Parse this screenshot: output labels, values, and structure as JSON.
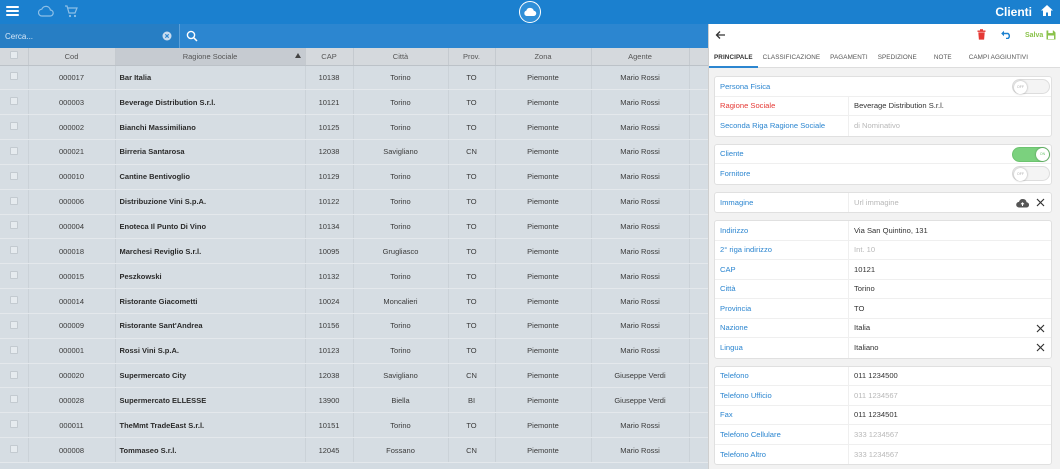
{
  "app": {
    "title": "Clienti",
    "icons": {
      "menu": "hamburger-icon",
      "cloud": "cloud-icon",
      "cart": "cart-icon",
      "home": "home-icon"
    }
  },
  "search": {
    "placeholder": "Cerca..."
  },
  "table": {
    "headers": [
      "Cod",
      "Ragione Sociale",
      "CAP",
      "Città",
      "Prov.",
      "Zona",
      "Agente"
    ],
    "sorted_column": "Ragione Sociale",
    "rows": [
      {
        "cod": "000017",
        "name": "Bar Italia",
        "cap": "10138",
        "city": "Torino",
        "prov": "TO",
        "zone": "Piemonte",
        "agent": "Mario Rossi"
      },
      {
        "cod": "000003",
        "name": "Beverage Distribution S.r.l.",
        "cap": "10121",
        "city": "Torino",
        "prov": "TO",
        "zone": "Piemonte",
        "agent": "Mario Rossi"
      },
      {
        "cod": "000002",
        "name": "Bianchi Massimiliano",
        "cap": "10125",
        "city": "Torino",
        "prov": "TO",
        "zone": "Piemonte",
        "agent": "Mario Rossi"
      },
      {
        "cod": "000021",
        "name": "Birreria Santarosa",
        "cap": "12038",
        "city": "Savigliano",
        "prov": "CN",
        "zone": "Piemonte",
        "agent": "Mario Rossi"
      },
      {
        "cod": "000010",
        "name": "Cantine Bentivoglio",
        "cap": "10129",
        "city": "Torino",
        "prov": "TO",
        "zone": "Piemonte",
        "agent": "Mario Rossi"
      },
      {
        "cod": "000006",
        "name": "Distribuzione Vini S.p.A.",
        "cap": "10122",
        "city": "Torino",
        "prov": "TO",
        "zone": "Piemonte",
        "agent": "Mario Rossi"
      },
      {
        "cod": "000004",
        "name": "Enoteca Il Punto Di Vino",
        "cap": "10134",
        "city": "Torino",
        "prov": "TO",
        "zone": "Piemonte",
        "agent": "Mario Rossi"
      },
      {
        "cod": "000018",
        "name": "Marchesi Reviglio S.r.l.",
        "cap": "10095",
        "city": "Grugliasco",
        "prov": "TO",
        "zone": "Piemonte",
        "agent": "Mario Rossi"
      },
      {
        "cod": "000015",
        "name": "Peszkowski",
        "cap": "10132",
        "city": "Torino",
        "prov": "TO",
        "zone": "Piemonte",
        "agent": "Mario Rossi"
      },
      {
        "cod": "000014",
        "name": "Ristorante Giacometti",
        "cap": "10024",
        "city": "Moncalieri",
        "prov": "TO",
        "zone": "Piemonte",
        "agent": "Mario Rossi"
      },
      {
        "cod": "000009",
        "name": "Ristorante Sant'Andrea",
        "cap": "10156",
        "city": "Torino",
        "prov": "TO",
        "zone": "Piemonte",
        "agent": "Mario Rossi"
      },
      {
        "cod": "000001",
        "name": "Rossi Vini S.p.A.",
        "cap": "10123",
        "city": "Torino",
        "prov": "TO",
        "zone": "Piemonte",
        "agent": "Mario Rossi"
      },
      {
        "cod": "000020",
        "name": "Supermercato City",
        "cap": "12038",
        "city": "Savigliano",
        "prov": "CN",
        "zone": "Piemonte",
        "agent": "Giuseppe Verdi"
      },
      {
        "cod": "000028",
        "name": "Supermercato ELLESSE",
        "cap": "13900",
        "city": "Biella",
        "prov": "BI",
        "zone": "Piemonte",
        "agent": "Giuseppe Verdi"
      },
      {
        "cod": "000011",
        "name": "TheMmt TradeEast S.r.l.",
        "cap": "10151",
        "city": "Torino",
        "prov": "TO",
        "zone": "Piemonte",
        "agent": "Mario Rossi"
      },
      {
        "cod": "000008",
        "name": "Tommaseo S.r.l.",
        "cap": "12045",
        "city": "Fossano",
        "prov": "CN",
        "zone": "Piemonte",
        "agent": "Mario Rossi"
      }
    ]
  },
  "panel": {
    "toolbar": {
      "save_label": "Salva"
    },
    "tabs": [
      "PRINCIPALE",
      "CLASSIFICAZIONE",
      "PAGAMENTI",
      "SPEDIZIONE",
      "NOTE",
      "CAMPI AGGIUNTIVI"
    ],
    "active_tab": "PRINCIPALE",
    "toggle_labels": {
      "on": "ON",
      "off": "OFF"
    },
    "group1": {
      "persona_fisica": {
        "label": "Persona Fisica",
        "state": "OFF"
      },
      "ragione_sociale": {
        "label": "Ragione Sociale",
        "value": "Beverage Distribution S.r.l."
      },
      "seconda_riga": {
        "label": "Seconda Riga Ragione Sociale",
        "placeholder": "di Nominativo"
      }
    },
    "group2": {
      "cliente": {
        "label": "Cliente",
        "state": "ON"
      },
      "fornitore": {
        "label": "Fornitore",
        "state": "OFF"
      }
    },
    "group3": {
      "immagine": {
        "label": "Immagine",
        "placeholder": "Url immagine"
      }
    },
    "group4": {
      "indirizzo": {
        "label": "Indirizzo",
        "value": "Via San Quintino, 131"
      },
      "riga2": {
        "label": "2° riga indirizzo",
        "placeholder": "Int. 10"
      },
      "cap": {
        "label": "CAP",
        "value": "10121"
      },
      "citta": {
        "label": "Città",
        "value": "Torino"
      },
      "provincia": {
        "label": "Provincia",
        "value": "TO"
      },
      "nazione": {
        "label": "Nazione",
        "value": "Italia"
      },
      "lingua": {
        "label": "Lingua",
        "value": "Italiano"
      }
    },
    "group5": {
      "telefono": {
        "label": "Telefono",
        "value": "011 1234500"
      },
      "telefono_ufficio": {
        "label": "Telefono Ufficio",
        "placeholder": "011 1234567"
      },
      "fax": {
        "label": "Fax",
        "value": "011 1234501"
      },
      "cellulare": {
        "label": "Telefono Cellulare",
        "placeholder": "333 1234567"
      },
      "altro": {
        "label": "Telefono Altro",
        "placeholder": "333 1234567"
      }
    }
  },
  "colors": {
    "topbar": "#1b80cf",
    "label_blue": "#2c86d0",
    "required_red": "#e53935",
    "save_green": "#8ac24a",
    "toggle_on": "#7bd17e"
  }
}
